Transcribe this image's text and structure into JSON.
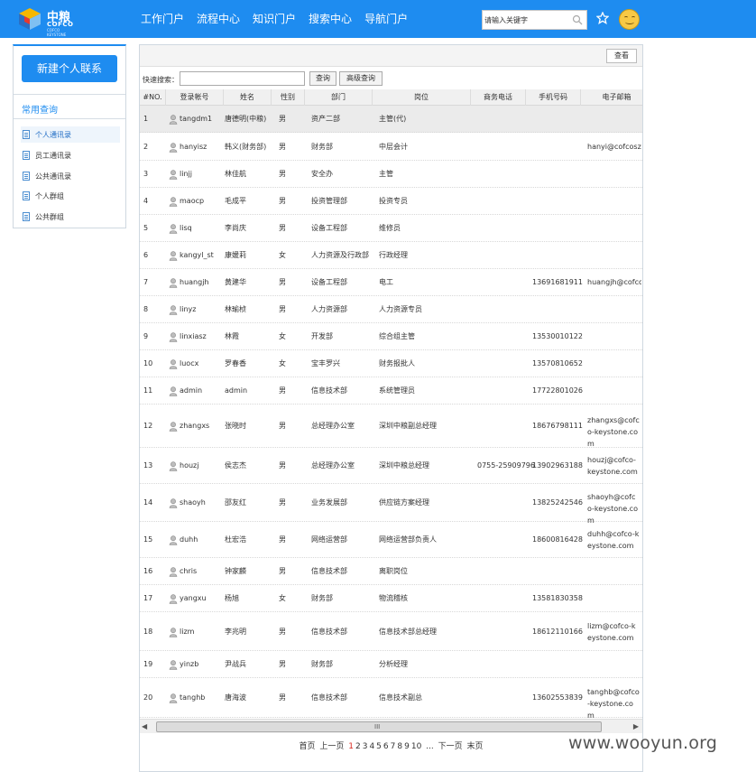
{
  "brand": {
    "name_cn": "中粮",
    "name_en": "COFCO",
    "sub": "COFCO KEYSTONE"
  },
  "nav": [
    "工作门户",
    "流程中心",
    "知识门户",
    "搜索中心",
    "导航门户"
  ],
  "search": {
    "value": "请输入关键字"
  },
  "sidebar": {
    "new_button": "新建个人联系",
    "section_title": "常用查询",
    "items": [
      "个人通讯录",
      "员工通讯录",
      "公共通讯录",
      "个人群组",
      "公共群组"
    ]
  },
  "toolbar": {
    "view_label": "查看"
  },
  "quick_search": {
    "label": "快速搜索：",
    "value": "",
    "search_button": "查询",
    "advanced_button": "高级查询"
  },
  "columns": [
    "#NO.",
    "登录帐号",
    "姓名",
    "性别",
    "部门",
    "岗位",
    "商务电话",
    "手机号码",
    "电子邮箱"
  ],
  "rows": [
    {
      "no": "1",
      "account": "tangdm1",
      "name": "唐德明(中粮)",
      "gender": "男",
      "dept": "资产二部",
      "post": "主管(代)",
      "phone": "",
      "mobile": "",
      "email": ""
    },
    {
      "no": "2",
      "account": "hanyisz",
      "name": "韩义(财务部)",
      "gender": "男",
      "dept": "财务部",
      "post": "中层会计",
      "phone": "",
      "mobile": "",
      "email": "hanyi@cofcosz.c"
    },
    {
      "no": "3",
      "account": "linjj",
      "name": "林佳航",
      "gender": "男",
      "dept": "安全办",
      "post": "主管",
      "phone": "",
      "mobile": "",
      "email": ""
    },
    {
      "no": "4",
      "account": "maocp",
      "name": "毛成平",
      "gender": "男",
      "dept": "投资管理部",
      "post": "投资专员",
      "phone": "",
      "mobile": "",
      "email": ""
    },
    {
      "no": "5",
      "account": "lisq",
      "name": "李尚庆",
      "gender": "男",
      "dept": "设备工程部",
      "post": "维修员",
      "phone": "",
      "mobile": "",
      "email": ""
    },
    {
      "no": "6",
      "account": "kangyl_st",
      "name": "康媛莉",
      "gender": "女",
      "dept": "人力资源及行政部",
      "post": "行政经理",
      "phone": "",
      "mobile": "",
      "email": ""
    },
    {
      "no": "7",
      "account": "huangjh",
      "name": "黄建华",
      "gender": "男",
      "dept": "设备工程部",
      "post": "电工",
      "phone": "",
      "mobile": "13691681911",
      "email": "huangjh@cofco"
    },
    {
      "no": "8",
      "account": "linyz",
      "name": "林瑜桢",
      "gender": "男",
      "dept": "人力资源部",
      "post": "人力资源专员",
      "phone": "",
      "mobile": "",
      "email": ""
    },
    {
      "no": "9",
      "account": "linxiasz",
      "name": "林霞",
      "gender": "女",
      "dept": "开发部",
      "post": "综合组主管",
      "phone": "",
      "mobile": "13530010122",
      "email": ""
    },
    {
      "no": "10",
      "account": "luocx",
      "name": "罗春香",
      "gender": "女",
      "dept": "宝丰罗兴",
      "post": "财务报批人",
      "phone": "",
      "mobile": "13570810652",
      "email": ""
    },
    {
      "no": "11",
      "account": "admin",
      "name": "admin",
      "gender": "男",
      "dept": "信息技术部",
      "post": "系统管理员",
      "phone": "",
      "mobile": "17722801026",
      "email": ""
    },
    {
      "no": "12",
      "account": "zhangxs",
      "name": "张晓时",
      "gender": "男",
      "dept": "总经理办公室",
      "post": "深圳中粮副总经理",
      "phone": "",
      "mobile": "18676798111",
      "email": "zhangxs@cofco-keystone.com"
    },
    {
      "no": "13",
      "account": "houzj",
      "name": "侯志杰",
      "gender": "男",
      "dept": "总经理办公室",
      "post": "深圳中粮总经理",
      "phone": "0755-25909796",
      "mobile": "13902963188",
      "email": "houzj@cofco-keystone.com"
    },
    {
      "no": "14",
      "account": "shaoyh",
      "name": "邵友红",
      "gender": "男",
      "dept": "业务发展部",
      "post": "供应链方案经理",
      "phone": "",
      "mobile": "13825242546",
      "email": "shaoyh@cofco-keystone.com"
    },
    {
      "no": "15",
      "account": "duhh",
      "name": "杜宏浩",
      "gender": "男",
      "dept": "网络运营部",
      "post": "网络运营部负责人",
      "phone": "",
      "mobile": "18600816428",
      "email": "duhh@cofco-keystone.com"
    },
    {
      "no": "16",
      "account": "chris",
      "name": "钟家麟",
      "gender": "男",
      "dept": "信息技术部",
      "post": "离职岗位",
      "phone": "",
      "mobile": "",
      "email": ""
    },
    {
      "no": "17",
      "account": "yangxu",
      "name": "杨旭",
      "gender": "女",
      "dept": "财务部",
      "post": "物流稽核",
      "phone": "",
      "mobile": "13581830358",
      "email": ""
    },
    {
      "no": "18",
      "account": "lizm",
      "name": "李兆明",
      "gender": "男",
      "dept": "信息技术部",
      "post": "信息技术部总经理",
      "phone": "",
      "mobile": "18612110166",
      "email": "lizm@cofco-keystone.com"
    },
    {
      "no": "19",
      "account": "yinzb",
      "name": "尹战兵",
      "gender": "男",
      "dept": "财务部",
      "post": "分析经理",
      "phone": "",
      "mobile": "",
      "email": ""
    },
    {
      "no": "20",
      "account": "tanghb",
      "name": "唐海波",
      "gender": "男",
      "dept": "信息技术部",
      "post": "信息技术副总",
      "phone": "",
      "mobile": "13602553839",
      "email": "tanghb@cofco-keystone.com"
    }
  ],
  "pager": {
    "first": "首页",
    "prev": "上一页",
    "pages": [
      "1",
      "2",
      "3",
      "4",
      "5",
      "6",
      "7",
      "8",
      "9",
      "10"
    ],
    "current": "1",
    "ellipsis": "...",
    "next": "下一页",
    "last": "末页"
  },
  "watermark": "www.wooyun.org",
  "colors": {
    "accent": "#1e8cf0",
    "current_page": "#d9261c"
  }
}
